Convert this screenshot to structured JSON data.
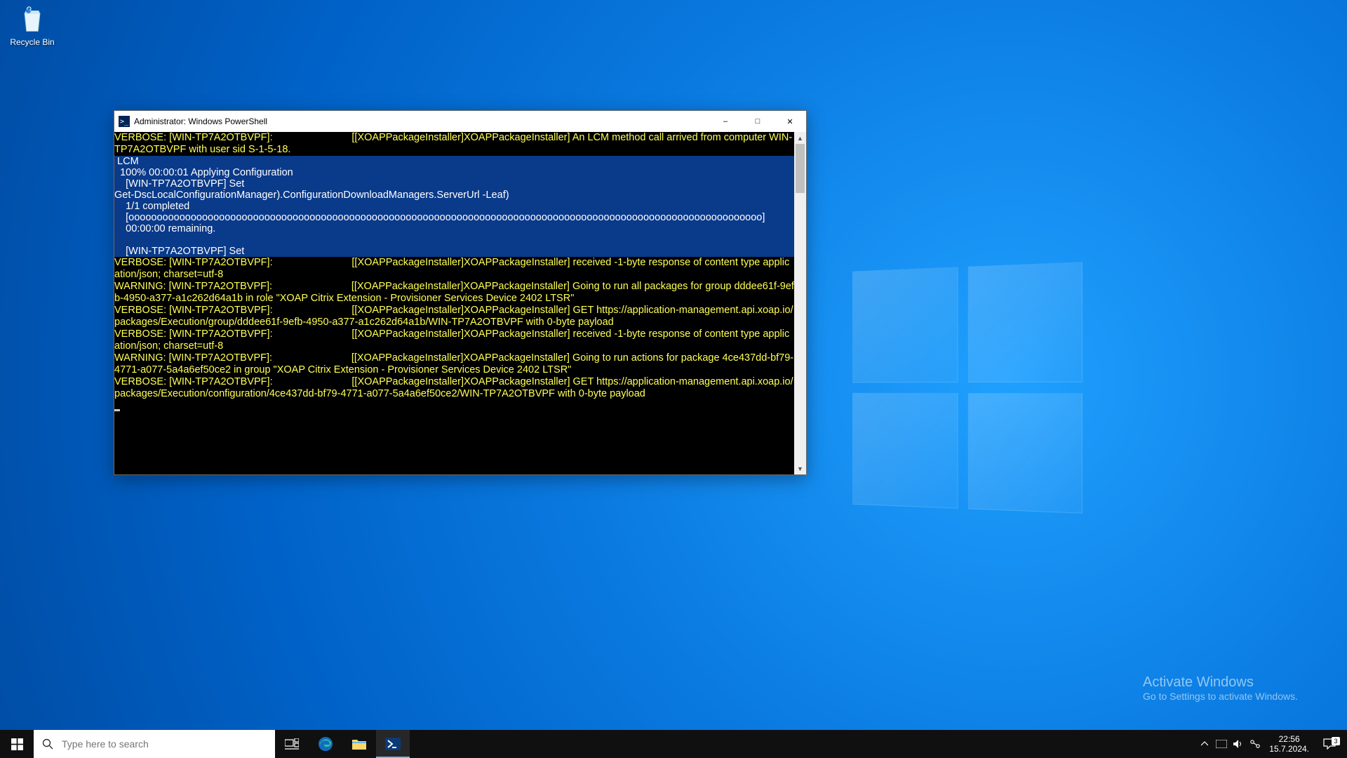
{
  "desktop": {
    "recycle_bin_label": "Recycle Bin",
    "watermark_title": "Activate Windows",
    "watermark_sub": "Go to Settings to activate Windows."
  },
  "powershell": {
    "title": "Administrator: Windows PowerShell",
    "lines": {
      "l0": "VERBOSE: [WIN-TP7A2OTBVPF]:                            [[XOAPPackageInstaller]XOAPPackageInstaller] An LCM method call arrived from computer WIN-TP7A2OTBVPF with user sid S-1-5-18.",
      "prog0": " LCM",
      "prog1": "  100% 00:00:01 Applying Configuration",
      "prog2": "    [WIN-TP7A2OTBVPF] Set",
      "prog3": "Get-DscLocalConfigurationManager).ConfigurationDownloadManagers.ServerUrl -Leaf)",
      "prog4": "    1/1 completed",
      "prog5": "    [oooooooooooooooooooooooooooooooooooooooooooooooooooooooooooooooooooooooooooooooooooooooooooooooooooooooooooooooo]",
      "prog6": "    00:00:00 remaining.",
      "prog7": " ",
      "prog8": "    [WIN-TP7A2OTBVPF] Set",
      "l1": "VERBOSE: [WIN-TP7A2OTBVPF]:                            [[XOAPPackageInstaller]XOAPPackageInstaller] received -1-byte response of content type application/json; charset=utf-8",
      "l2": "WARNING: [WIN-TP7A2OTBVPF]:                            [[XOAPPackageInstaller]XOAPPackageInstaller] Going to run all packages for group dddee61f-9efb-4950-a377-a1c262d64a1b in role \"XOAP Citrix Extension - Provisioner Services Device 2402 LTSR\"",
      "l3": "VERBOSE: [WIN-TP7A2OTBVPF]:                            [[XOAPPackageInstaller]XOAPPackageInstaller] GET https://application-management.api.xoap.io/packages/Execution/group/dddee61f-9efb-4950-a377-a1c262d64a1b/WIN-TP7A2OTBVPF with 0-byte payload",
      "l4": "VERBOSE: [WIN-TP7A2OTBVPF]:                            [[XOAPPackageInstaller]XOAPPackageInstaller] received -1-byte response of content type application/json; charset=utf-8",
      "l5": "WARNING: [WIN-TP7A2OTBVPF]:                            [[XOAPPackageInstaller]XOAPPackageInstaller] Going to run actions for package 4ce437dd-bf79-4771-a077-5a4a6ef50ce2 in group \"XOAP Citrix Extension - Provisioner Services Device 2402 LTSR\"",
      "l6": "VERBOSE: [WIN-TP7A2OTBVPF]:                            [[XOAPPackageInstaller]XOAPPackageInstaller] GET https://application-management.api.xoap.io/packages/Execution/configuration/4ce437dd-bf79-4771-a077-5a4a6ef50ce2/WIN-TP7A2OTBVPF with 0-byte payload"
    }
  },
  "taskbar": {
    "search_placeholder": "Type here to search",
    "clock_time": "22:56",
    "clock_date": "15.7.2024.",
    "notif_count": "3"
  }
}
